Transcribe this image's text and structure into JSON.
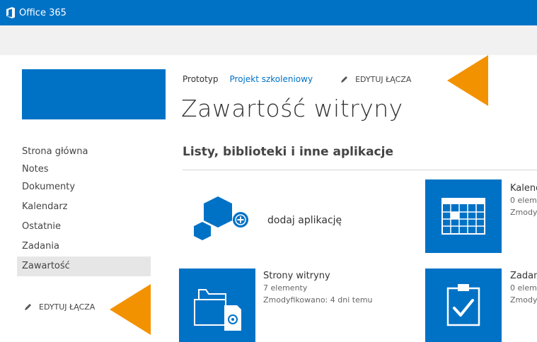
{
  "brand": {
    "name": "Office 365"
  },
  "nav": {
    "items": [
      {
        "label": "Strona główna"
      },
      {
        "label": "Notes"
      },
      {
        "label": "Dokumenty"
      },
      {
        "label": "Kalendarz"
      },
      {
        "label": "Ostatnie"
      },
      {
        "label": "Zadania"
      },
      {
        "label": "Zawartość",
        "selected": true
      }
    ],
    "edit_links": "EDYTUJ ŁĄCZA"
  },
  "breadcrumb": {
    "site": "Prototyp",
    "project": "Projekt szkoleniowy",
    "edit_links": "EDYTUJ ŁĄCZA"
  },
  "page": {
    "title": "Zawartość witryny",
    "section_heading": "Listy, biblioteki i inne aplikacje"
  },
  "add_app": {
    "label": "dodaj aplikację"
  },
  "tiles": [
    {
      "title": "Kalend",
      "meta": "0 elem",
      "modified": "Zmody"
    },
    {
      "title": "Strony witryny",
      "meta": "7 elementy",
      "modified": "Zmodyfikowano: 4 dni temu"
    },
    {
      "title": "Zadan",
      "meta": "0 elem",
      "modified": "Zmody"
    }
  ],
  "colors": {
    "brand_blue": "#0072c6",
    "accent_orange": "#f39200",
    "subbar": "#f1f1f1"
  }
}
